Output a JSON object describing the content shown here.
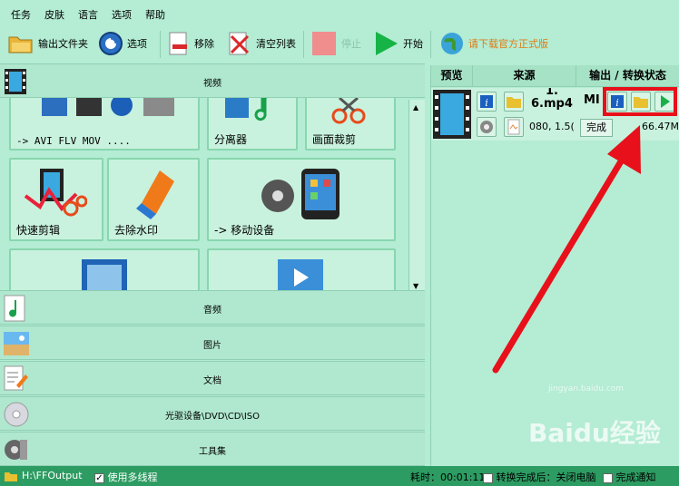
{
  "menu": [
    "任务",
    "皮肤",
    "语言",
    "选项",
    "帮助"
  ],
  "toolbar": {
    "output_folder": "输出文件夹",
    "options": "选项",
    "remove": "移除",
    "clear_list": "清空列表",
    "stop": "停止",
    "start": "开始",
    "download": "请下载官方正式版"
  },
  "categories": {
    "video": "视频",
    "audio": "音频",
    "image": "图片",
    "document": "文档",
    "rom": "光驱设备\\DVD\\CD\\ISO",
    "tools": "工具集"
  },
  "tiles": {
    "formats": "-> AVI FLV MOV ....",
    "splitter": "分离器",
    "crop": "画面裁剪",
    "quick_cut": "快速剪辑",
    "remove_watermark": "去除水印",
    "mobile": "-> 移动设备"
  },
  "table": {
    "col_preview": "预览",
    "col_source": "来源",
    "col_output": "输出 / 转换状态",
    "row": {
      "source_name_1": "1.",
      "source_name_2": "6.mp4",
      "source_info": "080, 1.5(",
      "output_name": "MI",
      "status": "完成",
      "size": "66.47M"
    }
  },
  "status": {
    "path": "H:\\FFOutput",
    "multithread": "使用多线程",
    "elapsed": "耗时：00:01:11",
    "after_done": "转换完成后：关闭电脑",
    "notify": "完成通知"
  },
  "watermark": {
    "brand": "Baidu经验",
    "url": "jingyan.baidu.com"
  },
  "colors": {
    "accent": "#2d9c62",
    "highlight": "#e8101a",
    "background": "#b4ecd4"
  }
}
